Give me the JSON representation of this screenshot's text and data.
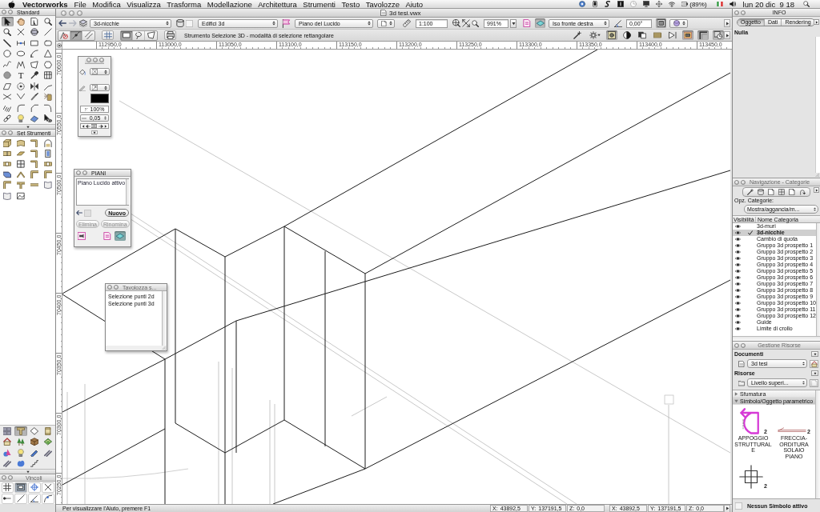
{
  "menu_bar": {
    "app_name": "Vectorworks",
    "menus": [
      "File",
      "Modifica",
      "Visualizza",
      "Trasforma",
      "Modellazione",
      "Architettura",
      "Strumenti",
      "Testo",
      "Tavolozze",
      "Aiuto"
    ],
    "battery": "(89%)",
    "clock": "lun 20 dic  9 18"
  },
  "tool_palettes": {
    "standard": {
      "title": "Standard",
      "tools": [
        {
          "selected": true
        },
        {
          "selected": false
        },
        {
          "selected": false
        },
        {
          "selected": false
        },
        {
          "selected": false
        },
        {
          "selected": false
        },
        {
          "selected": false
        },
        {
          "selected": false
        },
        {
          "selected": false
        },
        {
          "selected": false
        },
        {
          "selected": false
        },
        {
          "selected": false
        },
        {
          "selected": false
        },
        {
          "selected": false
        },
        {
          "selected": false
        },
        {
          "selected": false
        },
        {
          "selected": false
        },
        {
          "selected": false
        },
        {
          "selected": false
        },
        {
          "selected": false
        },
        {
          "selected": false
        },
        {
          "selected": false,
          "glyph": "T"
        },
        {
          "selected": false
        },
        {
          "selected": false
        },
        {
          "selected": false
        },
        {
          "selected": false
        },
        {
          "selected": false
        },
        {
          "selected": false
        },
        {
          "selected": false
        },
        {
          "selected": false
        },
        {
          "selected": false
        },
        {
          "selected": false
        },
        {
          "selected": false
        },
        {
          "selected": false
        },
        {
          "selected": false
        },
        {
          "selected": false
        },
        {
          "selected": false
        },
        {
          "selected": false
        },
        {
          "selected": false
        },
        {
          "selected": false
        }
      ]
    },
    "tool_sets": {
      "title": "Set Strumenti",
      "tools": [
        {
          "selected": false
        },
        {
          "selected": false
        },
        {
          "selected": false
        },
        {
          "selected": false
        },
        {
          "selected": false
        },
        {
          "selected": false
        },
        {
          "selected": false
        },
        {
          "selected": false
        },
        {
          "selected": false
        },
        {
          "selected": false
        },
        {
          "selected": false
        },
        {
          "selected": false
        },
        {
          "selected": false
        },
        {
          "selected": false
        },
        {
          "selected": false
        },
        {
          "selected": false
        },
        {
          "selected": false
        },
        {
          "selected": false
        },
        {
          "selected": false
        },
        {
          "selected": false
        },
        {
          "selected": false
        },
        {
          "selected": false
        }
      ],
      "sets": [
        {
          "selected": false
        },
        {
          "selected": true
        },
        {
          "selected": false
        },
        {
          "selected": false
        },
        {
          "selected": false
        },
        {
          "selected": false
        },
        {
          "selected": false
        },
        {
          "selected": false
        },
        {
          "selected": false
        },
        {
          "selected": false
        },
        {
          "selected": false
        },
        {
          "selected": false
        },
        {
          "selected": false
        },
        {
          "selected": false
        },
        {
          "selected": false
        }
      ]
    },
    "constraints": {
      "title": "Vincoli",
      "tools": [
        {
          "selected": false
        },
        {
          "selected": true
        },
        {
          "selected": false
        },
        {
          "selected": false
        },
        {
          "selected": false
        },
        {
          "selected": false
        },
        {
          "selected": false
        },
        {
          "selected": false
        }
      ]
    }
  },
  "window": {
    "title": "3d tesi.vwx"
  },
  "view_bar": {
    "nav": [
      {
        "disabled": false
      },
      {
        "disabled": true
      }
    ],
    "class": "3d-nicchie",
    "layer": "Edifici 3d",
    "sheet_layer": "Piano del Lucido",
    "scale": "1:100",
    "zoom": "991%",
    "toggles": [
      {
        "selected": false
      },
      {
        "selected": true
      }
    ],
    "view": "Iso fronte destra",
    "rotation": "0,00°",
    "projection": {
      "on": true
    }
  },
  "mode_bar": {
    "modes": [
      {
        "selected": false
      },
      {
        "selected": true
      },
      {
        "selected": false
      }
    ],
    "selection_modes": [
      {
        "selected": true
      },
      {
        "selected": false
      },
      {
        "selected": false
      }
    ],
    "hint": "Strumento Selezione 3D - modalità di selezione rettangolare",
    "options": [
      {
        "selected": false
      },
      {
        "selected": false
      },
      {
        "selected": true
      },
      {
        "selected": false
      },
      {
        "selected": false
      },
      {
        "selected": false
      },
      {
        "selected": false
      },
      {
        "selected": true
      },
      {
        "selected": true
      },
      {
        "selected": true
      }
    ]
  },
  "rulers": {
    "horizontal": [
      "112950,0",
      "113000,0",
      "113050,0",
      "113100,0",
      "113150,0",
      "113200,0",
      "113250,0",
      "113300,0",
      "113350,0",
      "113400,0",
      "113450,0"
    ],
    "vertical": [
      "70600,0",
      "70550,0",
      "70500,0",
      "70450,0",
      "70400,0",
      "70350,0",
      "70300,0",
      "70250,0"
    ]
  },
  "attributes_palette": {
    "opacity": "100%",
    "line_weight": "0,05"
  },
  "layers_palette": {
    "title": "PIANI",
    "items": [
      {
        "label": "Piano Lucido attivo",
        "selected": false
      }
    ],
    "buttons": [
      {
        "label": "Nuovo",
        "disabled": false
      },
      {
        "label": "Elimina",
        "disabled": true
      },
      {
        "label": "Rinomina",
        "disabled": true
      }
    ],
    "views": [
      {
        "selected": false
      },
      {
        "selected": false
      },
      {
        "selected": true
      }
    ]
  },
  "scripts_palette": {
    "title": "Tavolozza s...",
    "items": [
      "Selezione punti 2d",
      "Selezione punti 3d"
    ]
  },
  "info_palette": {
    "title": "INFO",
    "tabs": [
      {
        "label": "Oggetto",
        "selected": true
      },
      {
        "label": "Dati",
        "selected": false
      },
      {
        "label": "Rendering",
        "selected": false
      }
    ],
    "selection": "Nulla"
  },
  "navigation_palette": {
    "title": "Navigazione - Categorie",
    "options_label": "Opz. Categorie:",
    "options_value": "Mostra/aggancia/m...",
    "columns": [
      "Visibilità",
      "Nome Categoria"
    ],
    "categories": [
      {
        "name": "3d-muri",
        "visible": true,
        "selected": false
      },
      {
        "name": "3d-nicchie",
        "visible": true,
        "selected": true
      },
      {
        "name": "Cambio di quota",
        "visible": true,
        "selected": false
      },
      {
        "name": "Gruppo 3d prospetto 1",
        "visible": true,
        "selected": false
      },
      {
        "name": "Gruppo 3d prospetto 2",
        "visible": true,
        "selected": false
      },
      {
        "name": "Gruppo 3d prospetto 3",
        "visible": true,
        "selected": false
      },
      {
        "name": "Gruppo 3d prospetto 4",
        "visible": true,
        "selected": false
      },
      {
        "name": "Gruppo 3d prospetto 5",
        "visible": true,
        "selected": false
      },
      {
        "name": "Gruppo 3d prospetto 6",
        "visible": true,
        "selected": false
      },
      {
        "name": "Gruppo 3d prospetto 7",
        "visible": true,
        "selected": false
      },
      {
        "name": "Gruppo 3d prospetto 8",
        "visible": true,
        "selected": false
      },
      {
        "name": "Gruppo 3d prospetto 9",
        "visible": true,
        "selected": false
      },
      {
        "name": "Gruppo 3d prospetto 10",
        "visible": true,
        "selected": false
      },
      {
        "name": "Gruppo 3d prospetto 11",
        "visible": true,
        "selected": false
      },
      {
        "name": "Gruppo 3d prospetto 12",
        "visible": true,
        "selected": false
      },
      {
        "name": "Guide",
        "visible": true,
        "selected": false
      },
      {
        "name": "Limite di crollo",
        "visible": true,
        "selected": false
      }
    ]
  },
  "resource_palette": {
    "title": "Gestione Risorse",
    "documents_label": "Documenti",
    "document": "3d tesi",
    "resources_label": "Risorse",
    "resource_filter": "Livello superi...",
    "groups": [
      {
        "label": "Sfumatura",
        "expanded": false,
        "selected": false
      },
      {
        "label": "Simbolo/Oggetto parametrico",
        "expanded": true,
        "selected": true,
        "children": [
          {
            "label": "APPOGGIO STRUTTURALE",
            "marker": "2"
          },
          {
            "label": "FRECCIA-ORDITURA SOLAIO PIANO",
            "marker": "2"
          },
          {
            "marker": "2"
          }
        ]
      }
    ],
    "active_symbol": "Nessun Simbolo attivo"
  },
  "status_bar": {
    "hint": "Per visualizzare l'Aiuto, premere F1",
    "coordinates": [
      {
        "label": "X:",
        "value": "43892,5"
      },
      {
        "label": "Y:",
        "value": "137191,5"
      },
      {
        "label": "Z:",
        "value": "0,0"
      },
      {
        "label": "X:",
        "value": "43892,5"
      },
      {
        "label": "Y:",
        "value": "137191,5"
      },
      {
        "label": "Z:",
        "value": "0,0"
      }
    ]
  }
}
